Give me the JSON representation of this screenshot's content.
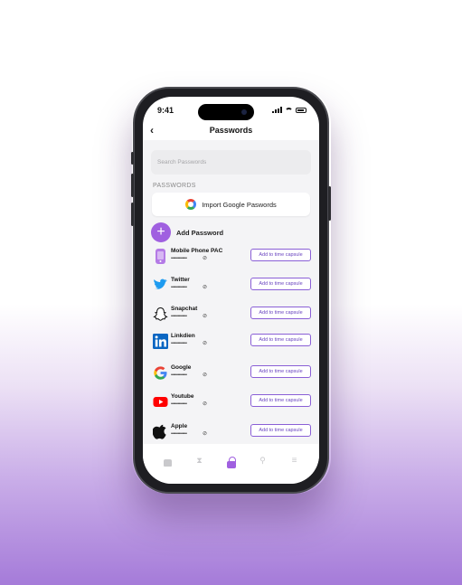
{
  "status_bar": {
    "time": "9:41"
  },
  "header": {
    "back": "‹",
    "title": "Passwords"
  },
  "search": {
    "placeholder": "Search Passwords"
  },
  "section_label": "PASSWORDS",
  "import_button": {
    "label": "Import Google Paswords"
  },
  "add_password": {
    "icon": "+",
    "label": "Add Password"
  },
  "password_items": [
    {
      "name": "Mobile Phone PAC",
      "masked": "••••••••••••••",
      "action": "Add to time capsule",
      "icon": "phone-icon"
    },
    {
      "name": "Twitter",
      "masked": "••••••••••••••",
      "action": "Add to time capsule",
      "icon": "twitter-icon"
    },
    {
      "name": "Snapchat",
      "masked": "••••••••••••••",
      "action": "Add to time capsule",
      "icon": "snapchat-icon"
    },
    {
      "name": "Linkdien",
      "masked": "••••••••••••••",
      "action": "Add to time capsule",
      "icon": "linkedin-icon"
    },
    {
      "name": "Google",
      "masked": "••••••••••••••",
      "action": "Add to time capsule",
      "icon": "google-icon"
    },
    {
      "name": "Youtube",
      "masked": "••••••••••••••",
      "action": "Add to time capsule",
      "icon": "youtube-icon"
    },
    {
      "name": "Apple",
      "masked": "••••••••••••••",
      "action": "Add to time capsule",
      "icon": "apple-icon"
    }
  ],
  "tabbar": {
    "tabs": [
      "home-icon",
      "hourglass-icon",
      "lock-icon",
      "key-icon",
      "menu-icon"
    ],
    "active": "lock-icon"
  },
  "colors": {
    "accent": "#a060e0",
    "capsule_border": "#8a5fd6"
  }
}
